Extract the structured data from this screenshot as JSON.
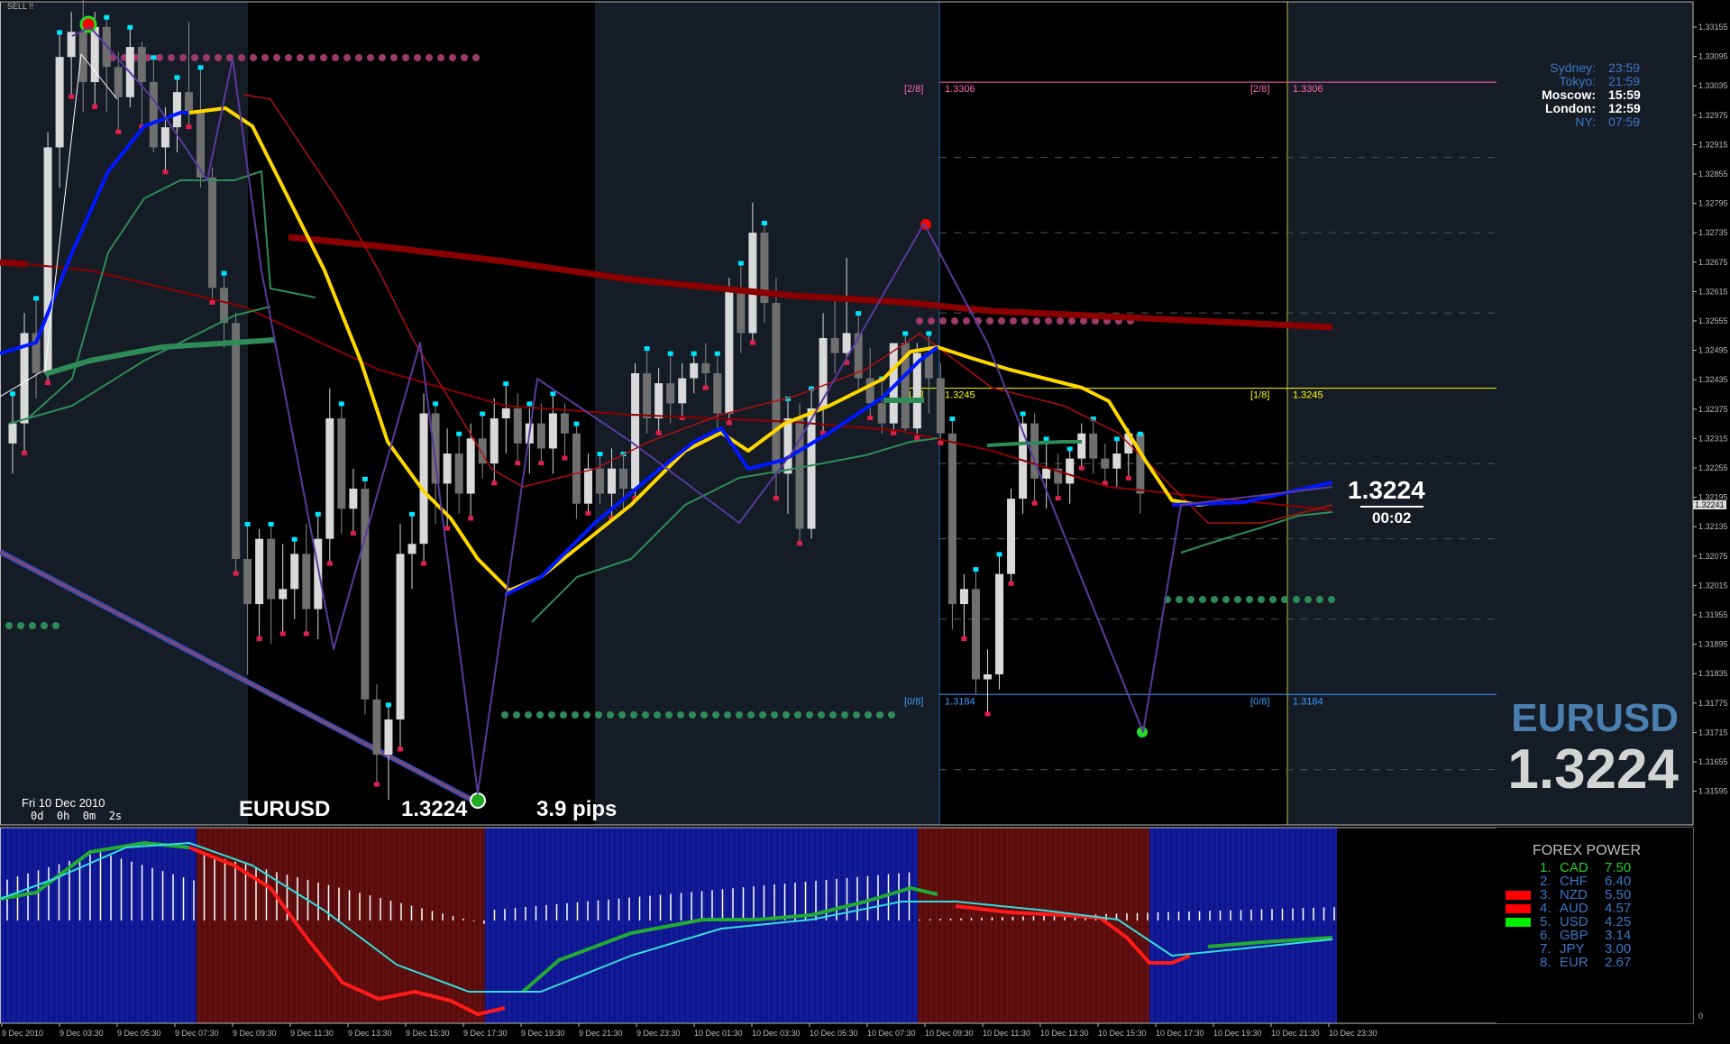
{
  "window": {
    "signal_label": "SELL !!"
  },
  "symbol": "EURUSD",
  "price_display": "1.3224",
  "candle_countdown": {
    "price": "1.3224",
    "time": "00:02"
  },
  "current_price_tag": "1.32241",
  "footer": {
    "date": "Fri 10 Dec 2010",
    "elapsed": "0d  0h  0m  2s",
    "symbol": "EURUSD",
    "price": "1.3224",
    "spread": "3.9 pips"
  },
  "clocks": [
    {
      "city": "Sydney:",
      "time": "23:59",
      "active": false
    },
    {
      "city": "Tokyo:",
      "time": "21:59",
      "active": false
    },
    {
      "city": "Moscow:",
      "time": "15:59",
      "active": true
    },
    {
      "city": "London:",
      "time": "12:59",
      "active": true
    },
    {
      "city": "NY:",
      "time": "07:59",
      "active": false
    }
  ],
  "murrey_levels": [
    {
      "tag": "[2/8]",
      "value": "1.3306",
      "color": "#ff69b4"
    },
    {
      "tag": "[1/8]",
      "value": "1.3245",
      "color": "#ffff00"
    },
    {
      "tag": "[0/8]",
      "value": "1.3184",
      "color": "#3b9cff"
    }
  ],
  "forex_power": {
    "title": "FOREX POWER",
    "rows": [
      {
        "rank": "1.",
        "ccy": "CAD",
        "val": "7.50",
        "color": "#22cc22"
      },
      {
        "rank": "2.",
        "ccy": "CHF",
        "val": "6.40",
        "color": "#3a78c8"
      },
      {
        "rank": "3.",
        "ccy": "NZD",
        "val": "5.50",
        "color": "#3a78c8"
      },
      {
        "rank": "4.",
        "ccy": "AUD",
        "val": "4.57",
        "color": "#3a78c8"
      },
      {
        "rank": "5.",
        "ccy": "USD",
        "val": "4.25",
        "color": "#3a78c8"
      },
      {
        "rank": "6.",
        "ccy": "GBP",
        "val": "3.14",
        "color": "#3a78c8"
      },
      {
        "rank": "7.",
        "ccy": "JPY",
        "val": "3.00",
        "color": "#3a78c8"
      },
      {
        "rank": "8.",
        "ccy": "EUR",
        "val": "2.67",
        "color": "#3a78c8"
      }
    ],
    "markers": [
      "#ff0000",
      "#ff0000",
      "#00ee00"
    ]
  },
  "price_axis": [
    "1.33155",
    "1.33095",
    "1.33035",
    "1.32975",
    "1.32915",
    "1.32855",
    "1.32795",
    "1.32735",
    "1.32675",
    "1.32615",
    "1.32555",
    "1.32495",
    "1.32435",
    "1.32375",
    "1.32315",
    "1.32255",
    "1.32195",
    "1.32135",
    "1.32075",
    "1.32015",
    "1.31955",
    "1.31895",
    "1.31835",
    "1.31775",
    "1.31715",
    "1.31655",
    "1.31595"
  ],
  "time_axis": [
    "9 Dec 2010",
    "9 Dec 03:30",
    "9 Dec 05:30",
    "9 Dec 07:30",
    "9 Dec 09:30",
    "9 Dec 11:30",
    "9 Dec 13:30",
    "9 Dec 15:30",
    "9 Dec 17:30",
    "9 Dec 19:30",
    "9 Dec 21:30",
    "9 Dec 23:30",
    "10 Dec 01:30",
    "10 Dec 03:30",
    "10 Dec 05:30",
    "10 Dec 07:30",
    "10 Dec 09:30",
    "10 Dec 11:30",
    "10 Dec 13:30",
    "10 Dec 15:30",
    "10 Dec 17:30",
    "10 Dec 19:30",
    "10 Dec 21:30",
    "10 Dec 23:30"
  ],
  "indicator_axis": [
    "0"
  ],
  "colors": {
    "background": "#000000",
    "session_bg": "#151c26",
    "bull_candle": "#d9d9d9",
    "bear_candle": "#6f6f6f",
    "ma_fast": "#ffd700",
    "ma_blue": "#0018ff",
    "ma_red": "#8b0000",
    "ma_green": "#2e8b57",
    "symbol_big": "#4a7fb0"
  },
  "chart_data": {
    "type": "candlestick",
    "candles": [
      {
        "o": 1.3234,
        "h": 1.3244,
        "l": 1.3228,
        "c": 1.3238
      },
      {
        "o": 1.3238,
        "h": 1.326,
        "l": 1.3232,
        "c": 1.3256
      },
      {
        "o": 1.3256,
        "h": 1.3263,
        "l": 1.3243,
        "c": 1.3248
      },
      {
        "o": 1.3248,
        "h": 1.3296,
        "l": 1.3246,
        "c": 1.3293
      },
      {
        "o": 1.3293,
        "h": 1.3316,
        "l": 1.3285,
        "c": 1.3311
      },
      {
        "o": 1.3311,
        "h": 1.332,
        "l": 1.3303,
        "c": 1.3316
      },
      {
        "o": 1.3316,
        "h": 1.3324,
        "l": 1.33,
        "c": 1.3306
      },
      {
        "o": 1.3306,
        "h": 1.332,
        "l": 1.3301,
        "c": 1.3317
      },
      {
        "o": 1.3317,
        "h": 1.3319,
        "l": 1.33,
        "c": 1.3309
      },
      {
        "o": 1.3309,
        "h": 1.3312,
        "l": 1.3296,
        "c": 1.3303
      },
      {
        "o": 1.3303,
        "h": 1.3317,
        "l": 1.3301,
        "c": 1.3313
      },
      {
        "o": 1.3313,
        "h": 1.3314,
        "l": 1.3297,
        "c": 1.3306
      },
      {
        "o": 1.3306,
        "h": 1.3311,
        "l": 1.3292,
        "c": 1.3293
      },
      {
        "o": 1.3293,
        "h": 1.3301,
        "l": 1.3288,
        "c": 1.3297
      },
      {
        "o": 1.3297,
        "h": 1.3307,
        "l": 1.3292,
        "c": 1.3304
      },
      {
        "o": 1.3304,
        "h": 1.3318,
        "l": 1.3297,
        "c": 1.33
      },
      {
        "o": 1.33,
        "h": 1.3309,
        "l": 1.3285,
        "c": 1.3287
      },
      {
        "o": 1.3287,
        "h": 1.3289,
        "l": 1.3262,
        "c": 1.3265
      },
      {
        "o": 1.3265,
        "h": 1.3268,
        "l": 1.3253,
        "c": 1.3258
      },
      {
        "o": 1.3258,
        "h": 1.326,
        "l": 1.3208,
        "c": 1.3211
      },
      {
        "o": 1.3211,
        "h": 1.3218,
        "l": 1.3188,
        "c": 1.3202
      },
      {
        "o": 1.3202,
        "h": 1.3217,
        "l": 1.3195,
        "c": 1.3215
      },
      {
        "o": 1.3215,
        "h": 1.3218,
        "l": 1.3194,
        "c": 1.3203
      },
      {
        "o": 1.3203,
        "h": 1.3214,
        "l": 1.3196,
        "c": 1.3205
      },
      {
        "o": 1.3205,
        "h": 1.3215,
        "l": 1.3199,
        "c": 1.3212
      },
      {
        "o": 1.3212,
        "h": 1.3218,
        "l": 1.3196,
        "c": 1.3201
      },
      {
        "o": 1.3201,
        "h": 1.322,
        "l": 1.3195,
        "c": 1.3215
      },
      {
        "o": 1.3215,
        "h": 1.3245,
        "l": 1.321,
        "c": 1.3239
      },
      {
        "o": 1.3239,
        "h": 1.3242,
        "l": 1.3216,
        "c": 1.3221
      },
      {
        "o": 1.3221,
        "h": 1.3229,
        "l": 1.3216,
        "c": 1.3225
      },
      {
        "o": 1.3225,
        "h": 1.3227,
        "l": 1.318,
        "c": 1.3183
      },
      {
        "o": 1.3183,
        "h": 1.3186,
        "l": 1.3166,
        "c": 1.3172
      },
      {
        "o": 1.3172,
        "h": 1.3182,
        "l": 1.3163,
        "c": 1.3179
      },
      {
        "o": 1.3179,
        "h": 1.3218,
        "l": 1.3173,
        "c": 1.3212
      },
      {
        "o": 1.3212,
        "h": 1.322,
        "l": 1.3205,
        "c": 1.3214
      },
      {
        "o": 1.3214,
        "h": 1.3244,
        "l": 1.321,
        "c": 1.324
      },
      {
        "o": 1.324,
        "h": 1.3242,
        "l": 1.3218,
        "c": 1.3226
      },
      {
        "o": 1.3226,
        "h": 1.3237,
        "l": 1.3217,
        "c": 1.3232
      },
      {
        "o": 1.3232,
        "h": 1.3236,
        "l": 1.322,
        "c": 1.3224
      },
      {
        "o": 1.3224,
        "h": 1.3238,
        "l": 1.3219,
        "c": 1.3235
      },
      {
        "o": 1.3235,
        "h": 1.324,
        "l": 1.3227,
        "c": 1.323
      },
      {
        "o": 1.323,
        "h": 1.3243,
        "l": 1.3226,
        "c": 1.3239
      },
      {
        "o": 1.3239,
        "h": 1.3246,
        "l": 1.3232,
        "c": 1.3241
      },
      {
        "o": 1.3241,
        "h": 1.3244,
        "l": 1.323,
        "c": 1.3234
      },
      {
        "o": 1.3234,
        "h": 1.3242,
        "l": 1.3228,
        "c": 1.3238
      },
      {
        "o": 1.3238,
        "h": 1.3242,
        "l": 1.323,
        "c": 1.3233
      },
      {
        "o": 1.3233,
        "h": 1.3244,
        "l": 1.3228,
        "c": 1.324
      },
      {
        "o": 1.324,
        "h": 1.3242,
        "l": 1.3231,
        "c": 1.3236
      },
      {
        "o": 1.3236,
        "h": 1.3238,
        "l": 1.3219,
        "c": 1.3222
      },
      {
        "o": 1.3222,
        "h": 1.3232,
        "l": 1.322,
        "c": 1.3229
      },
      {
        "o": 1.3229,
        "h": 1.3232,
        "l": 1.3222,
        "c": 1.3224
      },
      {
        "o": 1.3224,
        "h": 1.3233,
        "l": 1.3219,
        "c": 1.3229
      },
      {
        "o": 1.3229,
        "h": 1.3232,
        "l": 1.3221,
        "c": 1.3225
      },
      {
        "o": 1.3225,
        "h": 1.325,
        "l": 1.3223,
        "c": 1.3248
      },
      {
        "o": 1.3248,
        "h": 1.3253,
        "l": 1.3236,
        "c": 1.3239
      },
      {
        "o": 1.3239,
        "h": 1.3249,
        "l": 1.3236,
        "c": 1.3246
      },
      {
        "o": 1.3246,
        "h": 1.3252,
        "l": 1.3238,
        "c": 1.3242
      },
      {
        "o": 1.3242,
        "h": 1.325,
        "l": 1.3239,
        "c": 1.3247
      },
      {
        "o": 1.3247,
        "h": 1.3252,
        "l": 1.3244,
        "c": 1.325
      },
      {
        "o": 1.325,
        "h": 1.3254,
        "l": 1.3245,
        "c": 1.3248
      },
      {
        "o": 1.3248,
        "h": 1.3252,
        "l": 1.3237,
        "c": 1.324
      },
      {
        "o": 1.324,
        "h": 1.3267,
        "l": 1.3238,
        "c": 1.3265
      },
      {
        "o": 1.3265,
        "h": 1.327,
        "l": 1.3252,
        "c": 1.3256
      },
      {
        "o": 1.3256,
        "h": 1.3282,
        "l": 1.3254,
        "c": 1.3276
      },
      {
        "o": 1.3276,
        "h": 1.3278,
        "l": 1.3258,
        "c": 1.3262
      },
      {
        "o": 1.3262,
        "h": 1.3267,
        "l": 1.3223,
        "c": 1.3228
      },
      {
        "o": 1.3228,
        "h": 1.3243,
        "l": 1.322,
        "c": 1.3239
      },
      {
        "o": 1.3239,
        "h": 1.3242,
        "l": 1.3214,
        "c": 1.3217
      },
      {
        "o": 1.3217,
        "h": 1.3245,
        "l": 1.3215,
        "c": 1.3241
      },
      {
        "o": 1.3241,
        "h": 1.326,
        "l": 1.3236,
        "c": 1.3255
      },
      {
        "o": 1.3255,
        "h": 1.3263,
        "l": 1.3248,
        "c": 1.3252
      },
      {
        "o": 1.3252,
        "h": 1.3271,
        "l": 1.325,
        "c": 1.3256
      },
      {
        "o": 1.3256,
        "h": 1.326,
        "l": 1.3245,
        "c": 1.3247
      },
      {
        "o": 1.3247,
        "h": 1.3253,
        "l": 1.3239,
        "c": 1.3242
      },
      {
        "o": 1.3242,
        "h": 1.3247,
        "l": 1.3236,
        "c": 1.3238
      },
      {
        "o": 1.3238,
        "h": 1.3251,
        "l": 1.3236,
        "c": 1.3254
      },
      {
        "o": 1.3254,
        "h": 1.3256,
        "l": 1.3236,
        "c": 1.3237
      },
      {
        "o": 1.3237,
        "h": 1.3254,
        "l": 1.3235,
        "c": 1.3252
      },
      {
        "o": 1.3252,
        "h": 1.3256,
        "l": 1.324,
        "c": 1.3247
      },
      {
        "o": 1.3247,
        "h": 1.325,
        "l": 1.3234,
        "c": 1.3236
      },
      {
        "o": 1.3236,
        "h": 1.3239,
        "l": 1.3197,
        "c": 1.3202
      },
      {
        "o": 1.3202,
        "h": 1.3208,
        "l": 1.3195,
        "c": 1.3205
      },
      {
        "o": 1.3205,
        "h": 1.3209,
        "l": 1.3184,
        "c": 1.3187
      },
      {
        "o": 1.3187,
        "h": 1.3193,
        "l": 1.318,
        "c": 1.3188
      },
      {
        "o": 1.3188,
        "h": 1.3212,
        "l": 1.3185,
        "c": 1.3208
      },
      {
        "o": 1.3208,
        "h": 1.3225,
        "l": 1.3206,
        "c": 1.3223
      },
      {
        "o": 1.3223,
        "h": 1.324,
        "l": 1.322,
        "c": 1.3238
      },
      {
        "o": 1.3238,
        "h": 1.324,
        "l": 1.3222,
        "c": 1.3227
      },
      {
        "o": 1.3227,
        "h": 1.3235,
        "l": 1.3221,
        "c": 1.3229
      },
      {
        "o": 1.3229,
        "h": 1.3232,
        "l": 1.3223,
        "c": 1.3226
      },
      {
        "o": 1.3226,
        "h": 1.3233,
        "l": 1.3222,
        "c": 1.3231
      },
      {
        "o": 1.3231,
        "h": 1.3238,
        "l": 1.3229,
        "c": 1.3236
      },
      {
        "o": 1.3236,
        "h": 1.3239,
        "l": 1.3228,
        "c": 1.3231
      },
      {
        "o": 1.3231,
        "h": 1.3234,
        "l": 1.3226,
        "c": 1.3229
      },
      {
        "o": 1.3229,
        "h": 1.3235,
        "l": 1.3225,
        "c": 1.3232
      },
      {
        "o": 1.3232,
        "h": 1.3237,
        "l": 1.3227,
        "c": 1.3236
      },
      {
        "o": 1.3236,
        "h": 1.3236,
        "l": 1.322,
        "c": 1.3224
      }
    ],
    "ylim": [
      1.3158,
      1.3322
    ],
    "sell_signal_price": 1.3323,
    "murrey_prices": [
      1.3306,
      1.3245,
      1.3184
    ]
  }
}
